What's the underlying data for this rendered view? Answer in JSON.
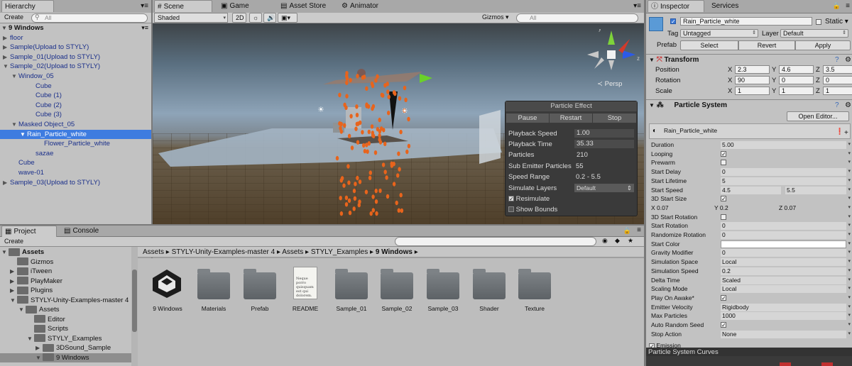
{
  "hierarchy": {
    "tab": "Hierarchy",
    "create": "Create",
    "search_placeholder": "All",
    "scene": "9 Windows",
    "items": [
      {
        "label": "floor",
        "indent": 1,
        "arrow": "▶"
      },
      {
        "label": "Sample(Upload to STYLY)",
        "indent": 1,
        "arrow": "▶"
      },
      {
        "label": "Sample_01(Upload to STYLY)",
        "indent": 1,
        "arrow": "▶"
      },
      {
        "label": "Sample_02(Upload to STYLY)",
        "indent": 1,
        "arrow": "▼"
      },
      {
        "label": "Window_05",
        "indent": 2,
        "arrow": "▼"
      },
      {
        "label": "Cube",
        "indent": 4,
        "arrow": ""
      },
      {
        "label": "Cube (1)",
        "indent": 4,
        "arrow": ""
      },
      {
        "label": "Cube (2)",
        "indent": 4,
        "arrow": ""
      },
      {
        "label": "Cube (3)",
        "indent": 4,
        "arrow": ""
      },
      {
        "label": "Masked Object_05",
        "indent": 2,
        "arrow": "▼"
      },
      {
        "label": "Rain_Particle_white",
        "indent": 3,
        "arrow": "▼",
        "selected": true
      },
      {
        "label": "Flower_Particle_white",
        "indent": 5,
        "arrow": ""
      },
      {
        "label": "sazae",
        "indent": 4,
        "arrow": ""
      },
      {
        "label": "Cube",
        "indent": 2,
        "arrow": ""
      },
      {
        "label": "wave-01",
        "indent": 2,
        "arrow": ""
      },
      {
        "label": "Sample_03(Upload to STYLY)",
        "indent": 1,
        "arrow": "▶"
      }
    ]
  },
  "scene": {
    "tabs": [
      "Scene",
      "Game",
      "Asset Store",
      "Animator"
    ],
    "shading": "Shaded",
    "mode2d": "2D",
    "gizmos": "Gizmos",
    "search_placeholder": "All",
    "persp": "Persp",
    "particle_effect": {
      "title": "Particle Effect",
      "buttons": [
        "Pause",
        "Restart",
        "Stop"
      ],
      "playback_speed_label": "Playback Speed",
      "playback_speed": "1.00",
      "playback_time_label": "Playback Time",
      "playback_time": "35.33",
      "particles_label": "Particles",
      "particles": "210",
      "sub_emitter_label": "Sub Emitter Particles",
      "sub_emitter": "55",
      "speed_range_label": "Speed Range",
      "speed_range": "0.2 - 5.5",
      "simulate_layers_label": "Simulate Layers",
      "simulate_layers": "Default",
      "resimulate": "Resimulate",
      "show_bounds": "Show Bounds"
    }
  },
  "project": {
    "tabs": [
      "Project",
      "Console"
    ],
    "create": "Create",
    "tree": [
      {
        "label": "Assets",
        "indent": 0,
        "arrow": "▼",
        "bold": true
      },
      {
        "label": "Gizmos",
        "indent": 1,
        "arrow": ""
      },
      {
        "label": "iTween",
        "indent": 1,
        "arrow": "▶"
      },
      {
        "label": "PlayMaker",
        "indent": 1,
        "arrow": "▶"
      },
      {
        "label": "Plugins",
        "indent": 1,
        "arrow": "▶"
      },
      {
        "label": "STYLY-Unity-Examples-master 4",
        "indent": 1,
        "arrow": "▼"
      },
      {
        "label": "Assets",
        "indent": 2,
        "arrow": "▼"
      },
      {
        "label": "Editor",
        "indent": 3,
        "arrow": ""
      },
      {
        "label": "Scripts",
        "indent": 3,
        "arrow": ""
      },
      {
        "label": "STYLY_Examples",
        "indent": 3,
        "arrow": "▼"
      },
      {
        "label": "3DSound_Sample",
        "indent": 4,
        "arrow": "▶"
      },
      {
        "label": "9 Windows",
        "indent": 4,
        "arrow": "▼",
        "selected": true
      }
    ],
    "breadcrumb": [
      "Assets",
      "STYLY-Unity-Examples-master 4",
      "Assets",
      "STYLY_Examples",
      "9 Windows"
    ],
    "assets": [
      {
        "label": "9 Windows",
        "kind": "unity"
      },
      {
        "label": "Materials",
        "kind": "folder"
      },
      {
        "label": "Prefab",
        "kind": "folder"
      },
      {
        "label": "README",
        "kind": "doc",
        "doc_text": "Neque porro quisquam est qui dolorem."
      },
      {
        "label": "Sample_01",
        "kind": "folder"
      },
      {
        "label": "Sample_02",
        "kind": "folder"
      },
      {
        "label": "Sample_03",
        "kind": "folder"
      },
      {
        "label": "Shader",
        "kind": "folder"
      },
      {
        "label": "Texture",
        "kind": "folder"
      }
    ]
  },
  "inspector": {
    "tabs": [
      "Inspector",
      "Services"
    ],
    "object_name": "Rain_Particle_white",
    "static_label": "Static",
    "tag_label": "Tag",
    "tag": "Untagged",
    "layer_label": "Layer",
    "layer": "Default",
    "prefab_label": "Prefab",
    "prefab_buttons": [
      "Select",
      "Revert",
      "Apply"
    ],
    "transform": {
      "title": "Transform",
      "rows": [
        {
          "label": "Position",
          "x": "2.3",
          "y": "4.6",
          "z": "3.5"
        },
        {
          "label": "Rotation",
          "x": "90",
          "y": "0",
          "z": "0"
        },
        {
          "label": "Scale",
          "x": "1",
          "y": "1",
          "z": "1"
        }
      ]
    },
    "particle_system": {
      "title": "Particle System",
      "open_editor": "Open Editor...",
      "module_name": "Rain_Particle_white",
      "rows": [
        {
          "label": "Duration",
          "value": "5.00"
        },
        {
          "label": "Looping",
          "value": "✓",
          "check": true
        },
        {
          "label": "Prewarm",
          "value": "",
          "check": true
        },
        {
          "label": "Start Delay",
          "value": "0"
        },
        {
          "label": "Start Lifetime",
          "value": "5"
        },
        {
          "label": "Start Speed",
          "value": "4.5",
          "value2": "5.5"
        },
        {
          "label": "3D Start Size",
          "value": "✓",
          "check": true
        },
        {
          "label": "X 0.07",
          "value": "Y 0.2",
          "value2": "Z 0.07"
        },
        {
          "label": "3D Start Rotation",
          "value": "",
          "check": true
        },
        {
          "label": "Start Rotation",
          "value": "0"
        },
        {
          "label": "Randomize Rotation",
          "value": "0"
        },
        {
          "label": "Start Color",
          "value": ""
        },
        {
          "label": "Gravity Modifier",
          "value": "0"
        },
        {
          "label": "Simulation Space",
          "value": "Local"
        },
        {
          "label": "Simulation Speed",
          "value": "0.2"
        },
        {
          "label": "Delta Time",
          "value": "Scaled"
        },
        {
          "label": "Scaling Mode",
          "value": "Local"
        },
        {
          "label": "Play On Awake*",
          "value": "✓",
          "check": true
        },
        {
          "label": "Emitter Velocity",
          "value": "Rigidbody"
        },
        {
          "label": "Max Particles",
          "value": "1000"
        },
        {
          "label": "Auto Random Seed",
          "value": "✓",
          "check": true
        },
        {
          "label": "Stop Action",
          "value": "None"
        }
      ],
      "emission": "Emission",
      "curves": "Particle System Curves"
    }
  }
}
